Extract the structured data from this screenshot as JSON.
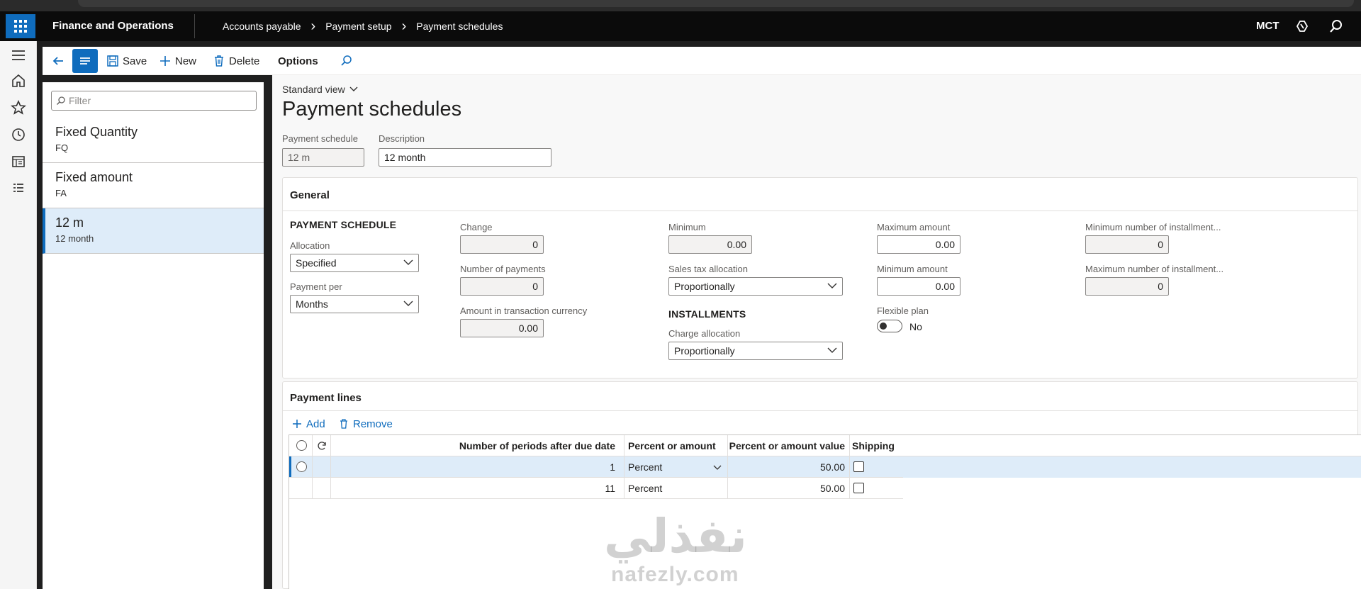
{
  "app": {
    "title": "Finance and Operations",
    "company": "MCT"
  },
  "breadcrumb": [
    "Accounts payable",
    "Payment setup",
    "Payment schedules"
  ],
  "toolbar": {
    "save": "Save",
    "new": "New",
    "delete": "Delete",
    "options": "Options"
  },
  "filter": {
    "placeholder": "Filter"
  },
  "list": [
    {
      "name": "Fixed Quantity",
      "code": "FQ"
    },
    {
      "name": "Fixed amount",
      "code": "FA"
    },
    {
      "name": "12 m",
      "code": "12 month"
    }
  ],
  "view": {
    "label": "Standard view"
  },
  "page": {
    "title": "Payment schedules"
  },
  "header_fields": {
    "schedule_label": "Payment schedule",
    "schedule_value": "12 m",
    "description_label": "Description",
    "description_value": "12 month"
  },
  "general": {
    "title": "General",
    "payment_schedule_heading": "PAYMENT SCHEDULE",
    "allocation_label": "Allocation",
    "allocation_value": "Specified",
    "payment_per_label": "Payment per",
    "payment_per_value": "Months",
    "change_label": "Change",
    "change_value": "0",
    "num_payments_label": "Number of payments",
    "num_payments_value": "0",
    "amount_txn_label": "Amount in transaction currency",
    "amount_txn_value": "0.00",
    "minimum_label": "Minimum",
    "minimum_value": "0.00",
    "sales_tax_label": "Sales tax allocation",
    "sales_tax_value": "Proportionally",
    "installments_heading": "INSTALLMENTS",
    "charge_alloc_label": "Charge allocation",
    "charge_alloc_value": "Proportionally",
    "max_amount_label": "Maximum amount",
    "max_amount_value": "0.00",
    "min_amount_label": "Minimum amount",
    "min_amount_value": "0.00",
    "flexible_label": "Flexible plan",
    "flexible_value": "No",
    "min_install_label": "Minimum number of installment...",
    "min_install_value": "0",
    "max_install_label": "Maximum number of installment...",
    "max_install_value": "0"
  },
  "payment_lines": {
    "title": "Payment lines",
    "add": "Add",
    "remove": "Remove",
    "columns": [
      "Number of periods after due date",
      "Percent or amount",
      "Percent or amount value",
      "Shipping"
    ],
    "rows": [
      {
        "periods": "1",
        "type": "Percent",
        "value": "50.00"
      },
      {
        "periods": "11",
        "type": "Percent",
        "value": "50.00"
      }
    ]
  },
  "watermark": {
    "arabic": "نفذلي",
    "latin": "nafezly.com"
  },
  "colors": {
    "accent": "#0f6cbd",
    "topbar": "#0b0b0b",
    "selected_row": "#deecf9"
  }
}
